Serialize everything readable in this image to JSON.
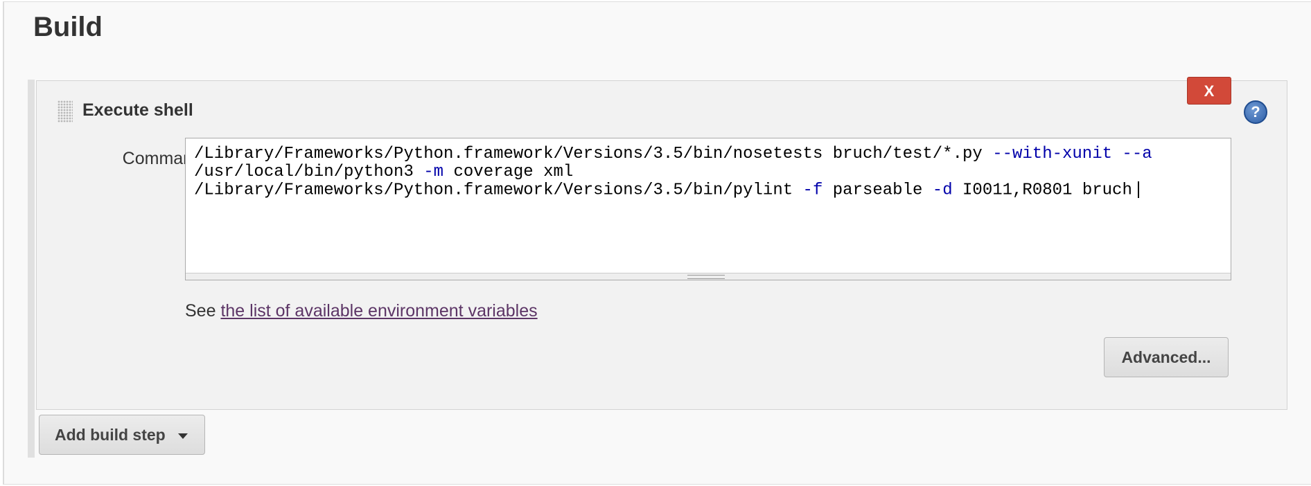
{
  "section": {
    "title": "Build"
  },
  "build_step": {
    "title": "Execute shell",
    "delete_label": "X",
    "help_label": "?",
    "command_label": "Command",
    "command_lines": [
      [
        {
          "text": "/Library/Frameworks/Python.framework/Versions/3.5/bin/nosetests bruch/test/*.py ",
          "kw": false
        },
        {
          "text": "--with-xunit --a",
          "kw": true
        }
      ],
      [
        {
          "text": "/usr/local/bin/python3 ",
          "kw": false
        },
        {
          "text": "-m",
          "kw": true
        },
        {
          "text": " coverage xml",
          "kw": false
        }
      ],
      [
        {
          "text": "/Library/Frameworks/Python.framework/Versions/3.5/bin/pylint ",
          "kw": false
        },
        {
          "text": "-f",
          "kw": true
        },
        {
          "text": " parseable ",
          "kw": false
        },
        {
          "text": "-d",
          "kw": true
        },
        {
          "text": " I0011,R0801 bruch",
          "kw": false
        }
      ]
    ],
    "env_prefix": "See ",
    "env_link": "the list of available environment variables",
    "advanced_label": "Advanced..."
  },
  "add_build_step_label": "Add build step",
  "colors": {
    "keyword": "#0000aa",
    "delete_button": "#d24939",
    "link": "#5c3566",
    "help_icon": "#2e5ea6"
  },
  "icons": {
    "drag_handle": "drag-handle-icon",
    "help": "help-icon",
    "dropdown": "chevron-down-icon"
  }
}
